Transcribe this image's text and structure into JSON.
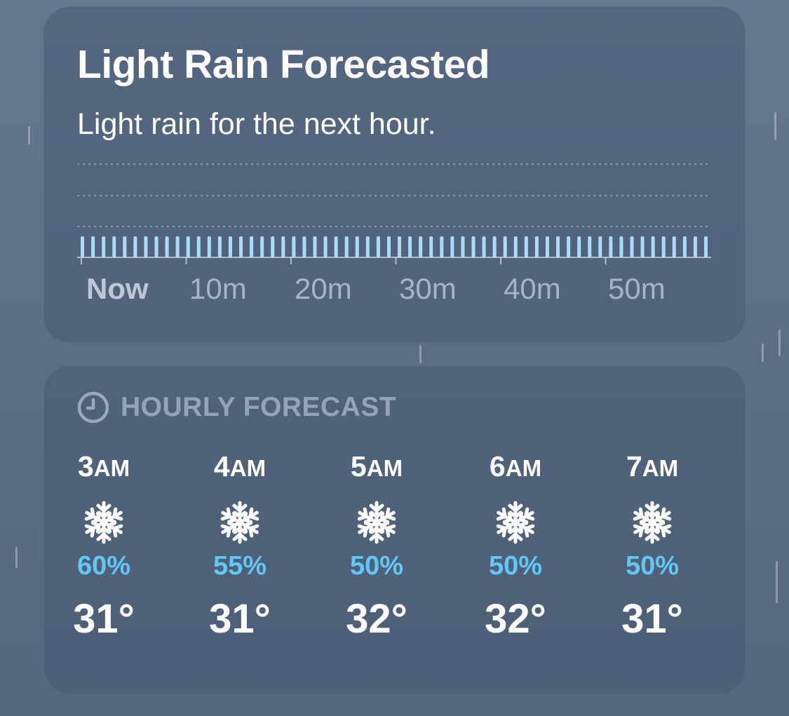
{
  "precipitation_card": {
    "title": "Light Rain Forecasted",
    "subtitle": "Light rain for the next hour.",
    "time_labels": [
      "Now",
      "10m",
      "20m",
      "30m",
      "40m",
      "50m"
    ],
    "intensity_level": "light",
    "bar_color": "#a9dcfb"
  },
  "hourly_card": {
    "header_icon": "clock-icon",
    "header": "HOURLY FORECAST",
    "hours": [
      {
        "hour": "3",
        "ampm": "AM",
        "icon": "snowflake-icon",
        "precip": "60%",
        "temp": "31°"
      },
      {
        "hour": "4",
        "ampm": "AM",
        "icon": "snowflake-icon",
        "precip": "55%",
        "temp": "31°"
      },
      {
        "hour": "5",
        "ampm": "AM",
        "icon": "snowflake-icon",
        "precip": "50%",
        "temp": "32°"
      },
      {
        "hour": "6",
        "ampm": "AM",
        "icon": "snowflake-icon",
        "precip": "50%",
        "temp": "32°"
      },
      {
        "hour": "7",
        "ampm": "AM",
        "icon": "snowflake-icon",
        "precip": "50%",
        "temp": "31°"
      }
    ],
    "precip_color": "#63c6f5"
  }
}
